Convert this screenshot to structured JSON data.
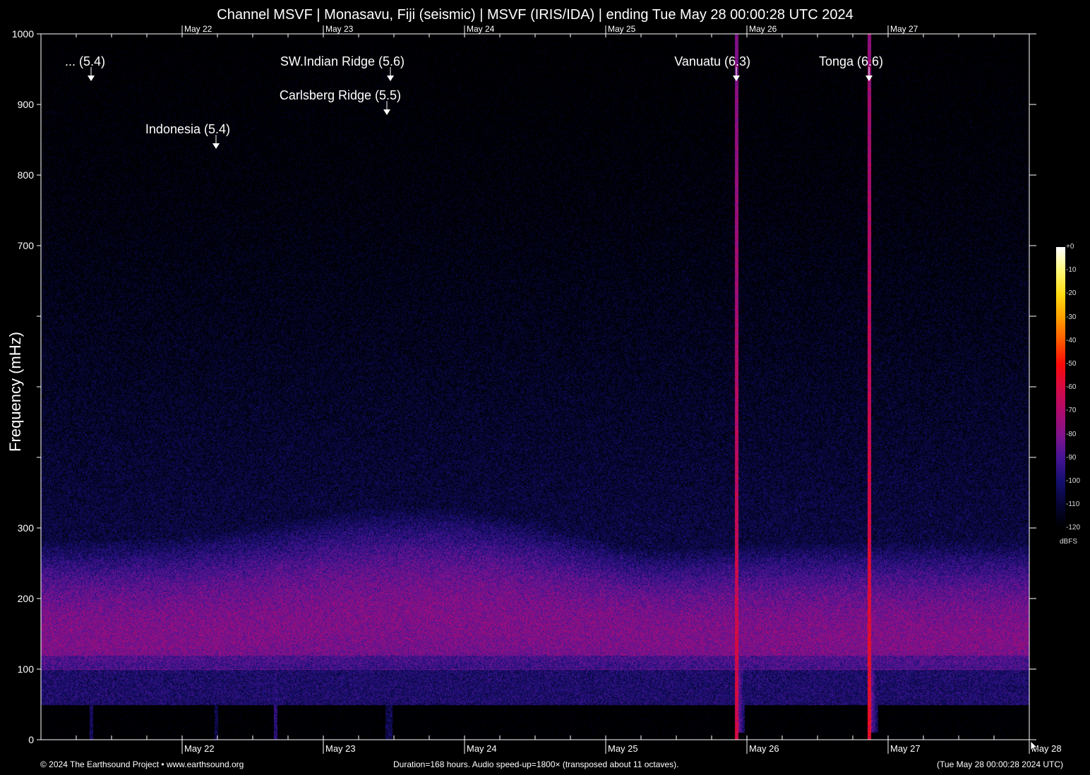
{
  "title": "Channel MSVF | Monasavu, Fiji (seismic) | MSVF (IRIS/IDA) | ending Tue May 28 00:00:28 UTC 2024",
  "footer": {
    "left": "© 2024 The Earthsound Project • www.earthsound.org",
    "middle": "Duration=168 hours. Audio speed-up=1800× (transposed about 11 octaves).",
    "right": "(Tue May 28 00:00:28 2024 UTC)"
  },
  "chart_data": {
    "type": "heatmap",
    "title": "Channel MSVF | Monasavu, Fiji (seismic) | MSVF (IRIS/IDA) | ending Tue May 28 00:00:28 UTC 2024",
    "xlabel": "",
    "ylabel": "Frequency (mHz)",
    "xlim_days_since_May21": [
      0,
      7
    ],
    "ylim": [
      0,
      1000
    ],
    "x_tick_labels": [
      "May 22",
      "May 23",
      "May 24",
      "May 25",
      "May 26",
      "May 27",
      "May 28"
    ],
    "x_tick_days": [
      1,
      2,
      3,
      4,
      5,
      6,
      7
    ],
    "y_tick_labels": [
      "0",
      "100",
      "200",
      "300",
      "700",
      "800",
      "900",
      "1000"
    ],
    "y_ticks": [
      0,
      100,
      200,
      300,
      400,
      500,
      600,
      700,
      800,
      900,
      1000
    ],
    "colorbar": {
      "unit": "dBFS",
      "range": [
        -120,
        0
      ],
      "tick_labels": [
        "+0",
        "-10",
        "-20",
        "-30",
        "-40",
        "-50",
        "-60",
        "-70",
        "-80",
        "-90",
        "-100",
        "-110",
        "-120"
      ]
    },
    "background_band": {
      "peak_freq_mHz": 165,
      "peak_dBFS": -80,
      "band_low_mHz": 100,
      "band_high_mHz": 280
    },
    "events": [
      {
        "label": "... (5.4)",
        "day": 0.355,
        "row": 0
      },
      {
        "label": "Indonesia (5.4)",
        "day": 1.24,
        "row": 2
      },
      {
        "label": "SW.Indian Ridge (5.6)",
        "day": 2.475,
        "row": 0
      },
      {
        "label": "Carlsberg Ridge (5.5)",
        "day": 2.45,
        "row": 1
      },
      {
        "label": "Vanuatu (6.3)",
        "day": 4.925,
        "row": 0
      },
      {
        "label": "Tonga (6.6)",
        "day": 5.865,
        "row": 0
      }
    ]
  }
}
